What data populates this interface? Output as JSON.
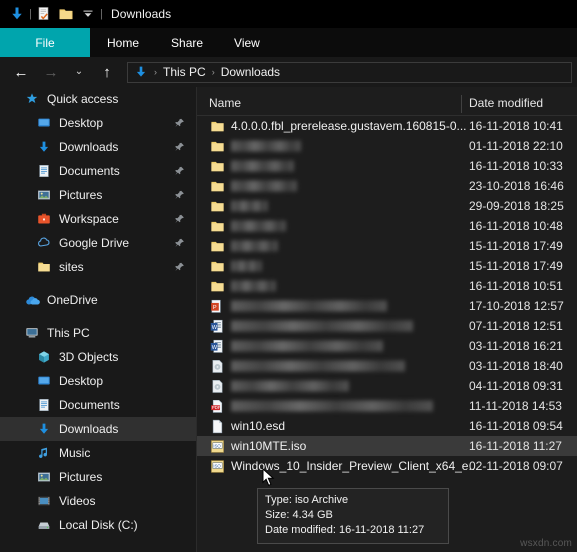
{
  "window": {
    "title": "Downloads",
    "quick_access_toolbar": [
      {
        "icon": "downloads-arrow-icon",
        "name": "downloads-quick-icon"
      },
      {
        "icon": "properties-icon",
        "name": "properties-quick-icon"
      },
      {
        "icon": "new-folder-icon",
        "name": "new-folder-quick-icon"
      },
      {
        "icon": "chevron-down-icon",
        "name": "customize-qat-dropdown"
      }
    ]
  },
  "ribbon": {
    "tabs": [
      {
        "label": "File",
        "active": true
      },
      {
        "label": "Home",
        "active": false
      },
      {
        "label": "Share",
        "active": false
      },
      {
        "label": "View",
        "active": false
      }
    ],
    "file_tab_color": "#00a5ad"
  },
  "address_bar": {
    "back_label": "←",
    "forward_label": "→",
    "recent_label": "⌄",
    "up_label": "↑",
    "breadcrumb": [
      "This PC",
      "Downloads"
    ],
    "separator": "›"
  },
  "nav_pane": {
    "sections": [
      {
        "header": {
          "label": "Quick access",
          "icon": "star-icon"
        },
        "items": [
          {
            "label": "Desktop",
            "icon": "desktop-icon",
            "pinned": true
          },
          {
            "label": "Downloads",
            "icon": "downloads-icon",
            "pinned": true
          },
          {
            "label": "Documents",
            "icon": "documents-icon",
            "pinned": true
          },
          {
            "label": "Pictures",
            "icon": "pictures-icon",
            "pinned": true
          },
          {
            "label": "Workspace",
            "icon": "briefcase-icon",
            "pinned": true
          },
          {
            "label": "Google Drive",
            "icon": "google-drive-icon",
            "pinned": true
          },
          {
            "label": "sites",
            "icon": "folder-icon",
            "pinned": true
          }
        ]
      },
      {
        "header": {
          "label": "OneDrive",
          "icon": "onedrive-cloud-icon"
        },
        "items": []
      },
      {
        "header": {
          "label": "This PC",
          "icon": "this-pc-icon"
        },
        "items": [
          {
            "label": "3D Objects",
            "icon": "3d-objects-icon",
            "pinned": false
          },
          {
            "label": "Desktop",
            "icon": "desktop-icon",
            "pinned": false
          },
          {
            "label": "Documents",
            "icon": "documents-icon",
            "pinned": false
          },
          {
            "label": "Downloads",
            "icon": "downloads-icon",
            "pinned": false,
            "selected": true
          },
          {
            "label": "Music",
            "icon": "music-icon",
            "pinned": false
          },
          {
            "label": "Pictures",
            "icon": "pictures-icon",
            "pinned": false
          },
          {
            "label": "Videos",
            "icon": "videos-icon",
            "pinned": false
          },
          {
            "label": "Local Disk (C:)",
            "icon": "disk-drive-icon",
            "pinned": false
          }
        ]
      }
    ]
  },
  "file_list": {
    "columns": [
      {
        "label": "Name",
        "sorted": true,
        "sort_direction": "ascending"
      },
      {
        "label": "Date modified",
        "sorted": false
      }
    ],
    "rows": [
      {
        "name": "4.0.0.0.fbl_prerelease.gustavem.160815-0...",
        "redacted": false,
        "icon": "folder-icon",
        "date": "16-11-2018 10:41"
      },
      {
        "name": "",
        "redacted": true,
        "redact_width": 70,
        "icon": "folder-icon",
        "date": "01-11-2018 22:10"
      },
      {
        "name": "",
        "redacted": true,
        "redact_width": 63,
        "icon": "folder-icon",
        "date": "16-11-2018 10:33"
      },
      {
        "name": "",
        "redacted": true,
        "redact_width": 66,
        "icon": "folder-icon",
        "date": "23-10-2018 16:46"
      },
      {
        "name": "",
        "redacted": true,
        "redact_width": 37,
        "icon": "folder-icon",
        "date": "29-09-2018 18:25"
      },
      {
        "name": "",
        "redacted": true,
        "redact_width": 55,
        "icon": "folder-icon",
        "date": "16-11-2018 10:48"
      },
      {
        "name": "",
        "redacted": true,
        "redact_width": 47,
        "icon": "folder-icon",
        "date": "15-11-2018 17:49"
      },
      {
        "name": "",
        "redacted": true,
        "redact_width": 31,
        "icon": "folder-icon",
        "date": "15-11-2018 17:49"
      },
      {
        "name": "",
        "redacted": true,
        "redact_width": 45,
        "icon": "folder-icon",
        "date": "16-11-2018 10:51"
      },
      {
        "name": "",
        "redacted": true,
        "redact_width": 156,
        "icon": "powerpoint-icon",
        "date": "17-10-2018 12:57"
      },
      {
        "name": "",
        "redacted": true,
        "redact_width": 182,
        "icon": "word-icon",
        "date": "07-11-2018 12:51"
      },
      {
        "name": "",
        "redacted": true,
        "redact_width": 152,
        "icon": "word-icon",
        "date": "03-11-2018 16:21"
      },
      {
        "name": "",
        "redacted": true,
        "redact_width": 174,
        "icon": "generic-file-icon",
        "date": "03-11-2018 18:40"
      },
      {
        "name": "",
        "redacted": true,
        "redact_width": 118,
        "icon": "generic-file-icon",
        "date": "04-11-2018 09:31"
      },
      {
        "name": "",
        "redacted": true,
        "redact_width": 202,
        "icon": "pdf-icon",
        "date": "11-11-2018 14:53"
      },
      {
        "name": "win10.esd",
        "redacted": false,
        "icon": "esd-file-icon",
        "date": "16-11-2018 09:54"
      },
      {
        "name": "win10MTE.iso",
        "redacted": false,
        "icon": "iso-file-icon",
        "date": "16-11-2018 11:27",
        "selected": true
      },
      {
        "name": "Windows_10_Insider_Preview_Client_x64_e...",
        "redacted": false,
        "icon": "iso-file-icon",
        "date": "02-11-2018 09:07"
      }
    ]
  },
  "tooltip": {
    "type_line": "Type: iso Archive",
    "size_line": "Size: 4.34 GB",
    "date_line": "Date modified: 16-11-2018 11:27"
  },
  "watermark": {
    "text": "wsxdn.com"
  }
}
